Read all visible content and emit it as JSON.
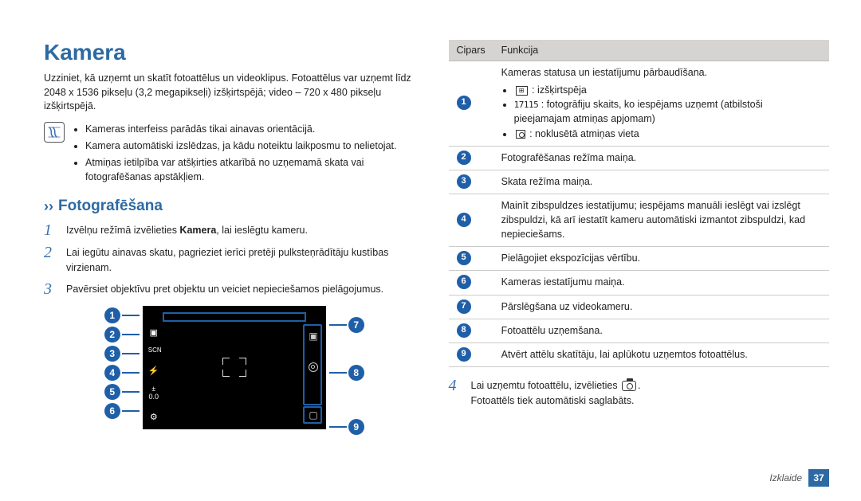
{
  "title": "Kamera",
  "intro": "Uzziniet, kā uzņemt un skatīt fotoattēlus un videoklipus. Fotoattēlus var uzņemt līdz 2048 x 1536 pikseļu (3,2 megapikseļi) izšķirtspējā; video – 720 x 480 pikseļu izšķirtspējā.",
  "notes": [
    "Kameras interfeiss parādās tikai ainavas orientācijā.",
    "Kamera automātiski izslēdzas, ja kādu noteiktu laikposmu to nelietojat.",
    "Atmiņas ietilpība var atšķirties atkarībā no uzņemamā skata vai fotografēšanas apstākļiem."
  ],
  "section_title": "Fotografēšana",
  "steps": {
    "s1a": "Izvēlņu režīmā izvēlieties ",
    "s1b": "Kamera",
    "s1c": ", lai ieslēgtu kameru.",
    "s2": "Lai iegūtu ainavas skatu, pagrieziet ierīci pretēji pulksteņrādītāju kustības virzienam.",
    "s3": "Pavērsiet objektīvu pret objektu un veiciet nepieciešamos pielāgojumus.",
    "s4a": "Lai uzņemtu fotoattēlu, izvēlieties ",
    "s4b": ".",
    "s4c": "Fotoattēls tiek automātiski saglabāts."
  },
  "nums": {
    "n1": "1",
    "n2": "2",
    "n3": "3",
    "n4": "4",
    "n5": "5",
    "n6": "6",
    "n7": "7",
    "n8": "8",
    "n9": "9"
  },
  "table": {
    "h1": "Cipars",
    "h2": "Funkcija",
    "r1": {
      "main": "Kameras statusa un iestatījumu pārbaudīšana.",
      "b1": " : izšķirtspēja",
      "b2a": " : fotogrāfiju skaits, ko iespējams uzņemt (atbilstoši pieejamajam atmiņas apjomam)",
      "b2num": "17115",
      "b3": " : noklusētā atmiņas vieta"
    },
    "r2": "Fotografēšanas režīma maiņa.",
    "r3": "Skata režīma maiņa.",
    "r4": "Mainīt zibspuldzes iestatījumu; iespējams manuāli ieslēgt vai izslēgt zibspuldzi, kā arī iestatīt kameru automātiski izmantot zibspuldzi, kad nepieciešams.",
    "r5": "Pielāgojiet ekspozīcijas vērtību.",
    "r6": "Kameras iestatījumu maiņa.",
    "r7": "Pārslēgšana uz videokameru.",
    "r8": "Fotoattēlu uzņemšana.",
    "r9": "Atvērt attēlu skatītāju, lai aplūkotu uzņemtos fotoattēlus."
  },
  "footer": {
    "section": "Izklaide",
    "page": "37"
  }
}
